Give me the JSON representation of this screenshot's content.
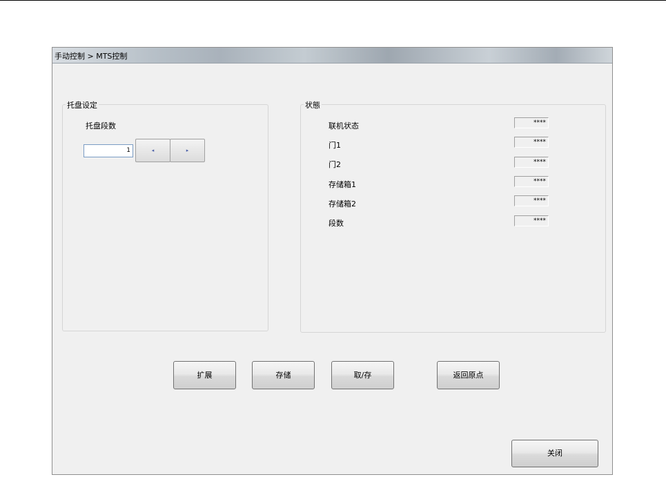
{
  "window": {
    "title": "手动控制 > MTS控制"
  },
  "tray_group": {
    "legend": "托盘设定",
    "label": "托盘段数",
    "value": "1",
    "prev_glyph": "◂",
    "next_glyph": "▸"
  },
  "status_group": {
    "legend": "状態",
    "items": [
      {
        "label": "联机状态",
        "value": "****"
      },
      {
        "label": "门1",
        "value": "****"
      },
      {
        "label": "门2",
        "value": "****"
      },
      {
        "label": "存储箱1",
        "value": "****"
      },
      {
        "label": "存储箱2",
        "value": "****"
      },
      {
        "label": "段数",
        "value": "****"
      }
    ]
  },
  "actions": {
    "expand": "扩展",
    "store": "存储",
    "retrieve": "取/存",
    "home": "返回原点",
    "close": "关闭"
  }
}
